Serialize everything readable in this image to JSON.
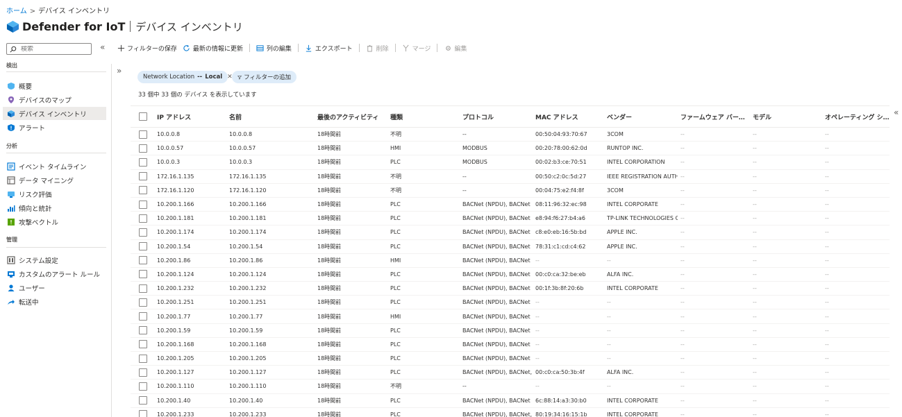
{
  "breadcrumb": {
    "home": "ホーム",
    "separator": ">",
    "current": "デバイス インベントリ"
  },
  "header": {
    "app_title": "Defender for IoT",
    "page_title": "デバイス インベントリ"
  },
  "sidebar": {
    "search_placeholder": "検索",
    "collapse": "«",
    "sections": [
      {
        "label": "検出",
        "items": [
          {
            "label": "概要",
            "icon": "overview-icon"
          },
          {
            "label": "デバイスのマップ",
            "icon": "map-pin-icon"
          },
          {
            "label": "デバイス インベントリ",
            "icon": "cube-icon",
            "active": true
          },
          {
            "label": "アラート",
            "icon": "shield-alert-icon"
          }
        ]
      },
      {
        "label": "分析",
        "items": [
          {
            "label": "イベント タイムライン",
            "icon": "timeline-icon"
          },
          {
            "label": "データ マイニング",
            "icon": "data-mining-icon"
          },
          {
            "label": "リスク評価",
            "icon": "risk-icon"
          },
          {
            "label": "傾向と統計",
            "icon": "chart-icon"
          },
          {
            "label": "攻撃ベクトル",
            "icon": "attack-vector-icon"
          }
        ]
      },
      {
        "label": "管理",
        "items": [
          {
            "label": "システム設定",
            "icon": "settings-icon"
          },
          {
            "label": "カスタムのアラート ルール",
            "icon": "custom-alert-icon"
          },
          {
            "label": "ユーザー",
            "icon": "user-icon"
          },
          {
            "label": "転送中",
            "icon": "forward-icon"
          }
        ]
      }
    ]
  },
  "toolbar": {
    "save_filter": "フィルターの保存",
    "refresh": "最新の情報に更新",
    "edit_columns": "列の編集",
    "export": "エクスポート",
    "delete": "削除",
    "merge": "マージ",
    "edit": "編集"
  },
  "filters": {
    "pill_key": "Network Location",
    "pill_op": "--",
    "pill_value": "Local",
    "add_filter": "フィルターの追加"
  },
  "count_text": "33 個中 33 個の デバイス を表示しています",
  "expand": "»",
  "right_collapse": "«",
  "colors": {
    "accent": "#0078d4",
    "pill_bg": "#deecf9",
    "active_nav": "#edebe9"
  },
  "table": {
    "columns": [
      "IP アドレス",
      "名前",
      "最後のアクティビティ",
      "種類",
      "プロトコル",
      "MAC アドレス",
      "ベンダー",
      "ファームウェア バージ...",
      "モデル",
      "オペレーティング シス..."
    ],
    "rows": [
      [
        "10.0.0.8",
        "10.0.0.8",
        "18時間前",
        "不明",
        "--",
        "00:50:04:93:70:67",
        "3COM",
        "--",
        "--",
        "--"
      ],
      [
        "10.0.0.57",
        "10.0.0.57",
        "18時間前",
        "HMI",
        "MODBUS",
        "00:20:78:00:62:0d",
        "RUNTOP INC.",
        "--",
        "--",
        "--"
      ],
      [
        "10.0.0.3",
        "10.0.0.3",
        "18時間前",
        "PLC",
        "MODBUS",
        "00:02:b3:ce:70:51",
        "INTEL CORPORATION",
        "--",
        "--",
        "--"
      ],
      [
        "172.16.1.135",
        "172.16.1.135",
        "18時間前",
        "不明",
        "--",
        "00:50:c2:0c:5d:27",
        "IEEE REGISTRATION AUTHO",
        "--",
        "--",
        "--"
      ],
      [
        "172.16.1.120",
        "172.16.1.120",
        "18時間前",
        "不明",
        "--",
        "00:04:75:e2:f4:8f",
        "3COM",
        "--",
        "--",
        "--"
      ],
      [
        "10.200.1.166",
        "10.200.1.166",
        "18時間前",
        "PLC",
        "BACNet (NPDU), BACNet",
        "08:11:96:32:ec:98",
        "INTEL CORPORATE",
        "--",
        "--",
        "--"
      ],
      [
        "10.200.1.181",
        "10.200.1.181",
        "18時間前",
        "PLC",
        "BACNet (NPDU), BACNet",
        "e8:94:f6:27:b4:a6",
        "TP-LINK TECHNOLOGIES CO.",
        "--",
        "--",
        "--"
      ],
      [
        "10.200.1.174",
        "10.200.1.174",
        "18時間前",
        "PLC",
        "BACNet (NPDU), BACNet",
        "c8:e0:eb:16:5b:bd",
        "APPLE INC.",
        "--",
        "--",
        "--"
      ],
      [
        "10.200.1.54",
        "10.200.1.54",
        "18時間前",
        "PLC",
        "BACNet (NPDU), BACNet",
        "78:31:c1:cd:c4:62",
        "APPLE INC.",
        "--",
        "--",
        "--"
      ],
      [
        "10.200.1.86",
        "10.200.1.86",
        "18時間前",
        "HMI",
        "BACNet (NPDU), BACNet",
        "--",
        "--",
        "--",
        "--",
        "--"
      ],
      [
        "10.200.1.124",
        "10.200.1.124",
        "18時間前",
        "PLC",
        "BACNet (NPDU), BACNet",
        "00:c0:ca:32:be:eb",
        "ALFA INC.",
        "--",
        "--",
        "--"
      ],
      [
        "10.200.1.232",
        "10.200.1.232",
        "18時間前",
        "PLC",
        "BACNet (NPDU), BACNet",
        "00:1f:3b:8f:20:6b",
        "INTEL CORPORATE",
        "--",
        "--",
        "--"
      ],
      [
        "10.200.1.251",
        "10.200.1.251",
        "18時間前",
        "PLC",
        "BACNet (NPDU), BACNet",
        "--",
        "--",
        "--",
        "--",
        "--"
      ],
      [
        "10.200.1.77",
        "10.200.1.77",
        "18時間前",
        "HMI",
        "BACNet (NPDU), BACNet",
        "--",
        "--",
        "--",
        "--",
        "--"
      ],
      [
        "10.200.1.59",
        "10.200.1.59",
        "18時間前",
        "PLC",
        "BACNet (NPDU), BACNet",
        "--",
        "--",
        "--",
        "--",
        "--"
      ],
      [
        "10.200.1.168",
        "10.200.1.168",
        "18時間前",
        "PLC",
        "BACNet (NPDU), BACNet",
        "--",
        "--",
        "--",
        "--",
        "--"
      ],
      [
        "10.200.1.205",
        "10.200.1.205",
        "18時間前",
        "PLC",
        "BACNet (NPDU), BACNet",
        "--",
        "--",
        "--",
        "--",
        "--"
      ],
      [
        "10.200.1.127",
        "10.200.1.127",
        "18時間前",
        "PLC",
        "BACNet (NPDU), BACNet, IC",
        "00:c0:ca:50:3b:4f",
        "ALFA INC.",
        "--",
        "--",
        "--"
      ],
      [
        "10.200.1.110",
        "10.200.1.110",
        "18時間前",
        "不明",
        "--",
        "--",
        "--",
        "--",
        "--",
        "--"
      ],
      [
        "10.200.1.40",
        "10.200.1.40",
        "18時間前",
        "PLC",
        "BACNet (NPDU), BACNet",
        "6c:88:14:a3:30:b0",
        "INTEL CORPORATE",
        "--",
        "--",
        "--"
      ],
      [
        "10.200.1.233",
        "10.200.1.233",
        "18時間前",
        "PLC",
        "BACNet (NPDU), BACNet, IC",
        "80:19:34:16:15:1b",
        "INTEL CORPORATE",
        "--",
        "--",
        "--"
      ]
    ]
  }
}
